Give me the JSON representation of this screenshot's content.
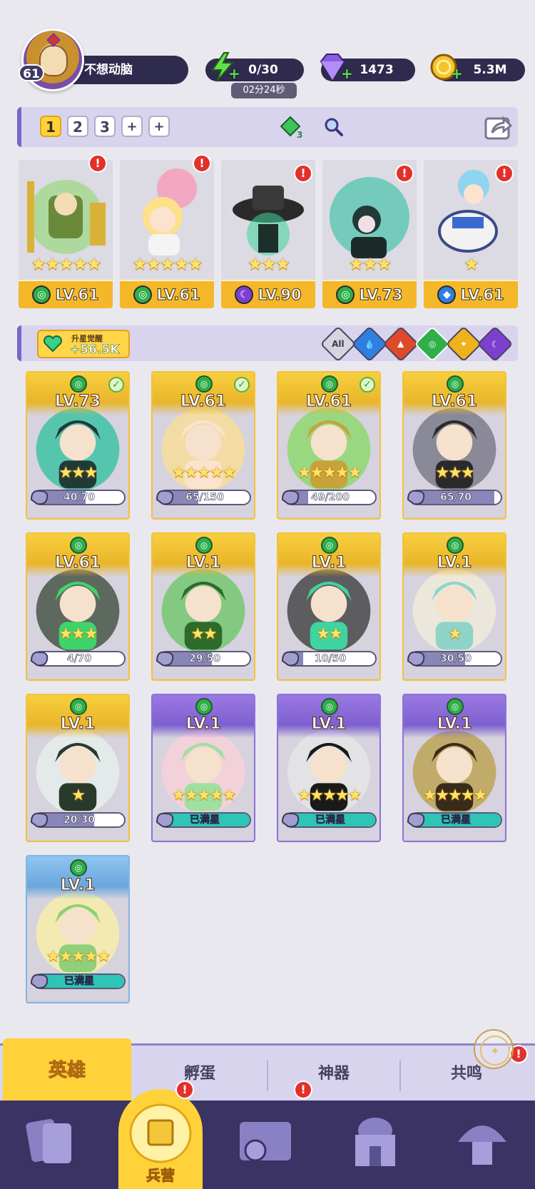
{
  "player": {
    "level": "61",
    "name": "不想动脑"
  },
  "resources": {
    "energy": "0/30",
    "energy_timer": "02分24秒",
    "gems": "1473",
    "gold": "5.3M"
  },
  "team": {
    "tabs": [
      "1",
      "2",
      "3",
      "+",
      "+"
    ],
    "active_tab": "1",
    "gem_count": "3"
  },
  "team_cards": [
    {
      "level": "LV.61",
      "element": "nature",
      "stars": "★★★★★",
      "alert": "!"
    },
    {
      "level": "LV.61",
      "element": "nature",
      "stars": "★★★★★",
      "alert": "!"
    },
    {
      "level": "LV.90",
      "element": "dark",
      "stars": "★★★",
      "alert": "!"
    },
    {
      "level": "LV.73",
      "element": "nature",
      "stars": "★★★",
      "alert": "!"
    },
    {
      "level": "LV.61",
      "element": "water",
      "stars": "★",
      "alert": "!"
    }
  ],
  "filter": {
    "awaken_title": "升星觉醒",
    "awaken_value": "+56.5K",
    "chips": [
      "All",
      "water",
      "fire",
      "nature",
      "light",
      "dark"
    ]
  },
  "heroes": [
    {
      "level": "LV.73",
      "stars": "★★★",
      "shards": "40/70",
      "progress": 0.57,
      "rarity": "gold",
      "checked": true
    },
    {
      "level": "LV.61",
      "stars": "★★★★★",
      "shards": "65/150",
      "progress": 0.43,
      "rarity": "gold",
      "checked": true
    },
    {
      "level": "LV.61",
      "stars": "★★★★★",
      "shards": "49/200",
      "progress": 0.25,
      "rarity": "gold",
      "checked": true
    },
    {
      "level": "LV.61",
      "stars": "★★★",
      "shards": "65/70",
      "progress": 0.93,
      "rarity": "gold",
      "checked": false
    },
    {
      "level": "LV.61",
      "stars": "★★★",
      "shards": "4/70",
      "progress": 0.06,
      "rarity": "gold",
      "checked": false
    },
    {
      "level": "LV.1",
      "stars": "★★",
      "shards": "29/50",
      "progress": 0.58,
      "rarity": "gold",
      "checked": false
    },
    {
      "level": "LV.1",
      "stars": "★★",
      "shards": "10/50",
      "progress": 0.2,
      "rarity": "gold",
      "checked": false
    },
    {
      "level": "LV.1",
      "stars": "★",
      "shards": "30/50",
      "progress": 0.6,
      "rarity": "gold",
      "checked": false
    },
    {
      "level": "LV.1",
      "stars": "★",
      "shards": "20/30",
      "progress": 0.67,
      "rarity": "gold",
      "checked": false
    },
    {
      "level": "LV.1",
      "stars": "★★★★★",
      "shards": "已满星",
      "progress": 1,
      "rarity": "purple",
      "checked": false
    },
    {
      "level": "LV.1",
      "stars": "★★★★★",
      "shards": "已满星",
      "progress": 1,
      "rarity": "purple",
      "checked": false
    },
    {
      "level": "LV.1",
      "stars": "★★★★★",
      "shards": "已满星",
      "progress": 1,
      "rarity": "purple",
      "checked": false
    },
    {
      "level": "LV.1",
      "stars": "★★★★★",
      "shards": "已满星",
      "progress": 1,
      "rarity": "blue",
      "checked": false
    }
  ],
  "sub_tabs": [
    "英雄",
    "孵蛋",
    "神器",
    "共鸣"
  ],
  "nav": {
    "active_label": "兵营",
    "alert": "!"
  },
  "colors": {
    "accent": "#ffd23a",
    "nav_bg": "#3a3363",
    "panel": "#d8d4ee"
  }
}
